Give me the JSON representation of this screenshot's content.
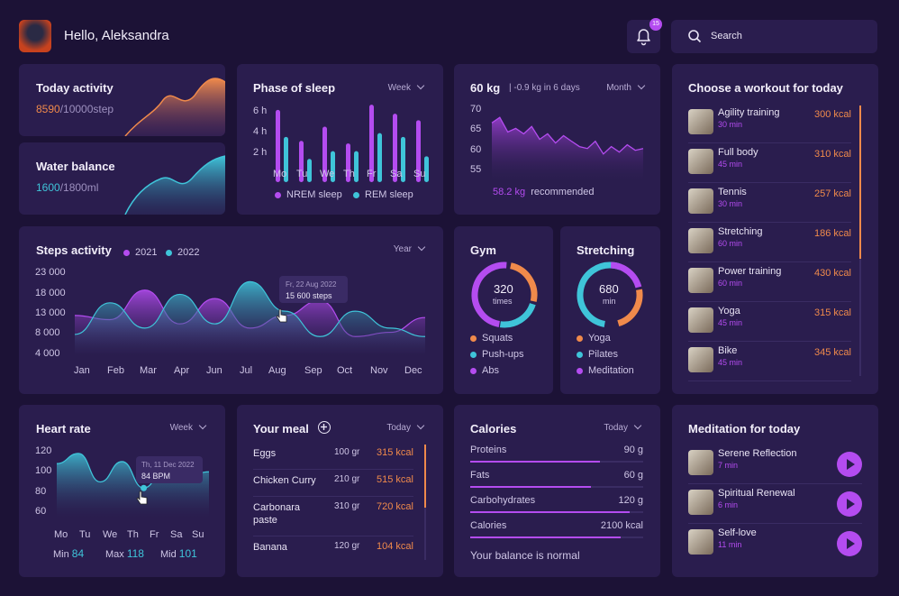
{
  "header": {
    "greeting": "Hello, Aleksandra",
    "notif_count": "15",
    "search_placeholder": "Search"
  },
  "today_activity": {
    "title": "Today activity",
    "value": "8590",
    "total": "/10000step"
  },
  "water": {
    "title": "Water balance",
    "value": "1600",
    "total": "/1800ml"
  },
  "sleep": {
    "title": "Phase of sleep",
    "period": "Week",
    "yticks": [
      "6 h",
      "4 h",
      "2 h"
    ],
    "days": [
      "Mo",
      "Tu",
      "We",
      "Th",
      "Fr",
      "Sa",
      "Su"
    ],
    "legend": [
      "NREM sleep",
      "REM sleep"
    ],
    "chart_data": {
      "type": "bar",
      "categories": [
        "Mo",
        "Tu",
        "We",
        "Th",
        "Fr",
        "Sa",
        "Su"
      ],
      "series": [
        {
          "name": "NREM sleep",
          "values": [
            5.6,
            3.2,
            4.3,
            3.0,
            6.0,
            5.3,
            4.8
          ]
        },
        {
          "name": "REM sleep",
          "values": [
            3.5,
            1.8,
            2.4,
            2.4,
            3.8,
            3.5,
            2.0
          ]
        }
      ],
      "ylim": [
        0,
        6.5
      ]
    }
  },
  "weight": {
    "title": "60 kg",
    "delta": "-0.9 kg in 6 days",
    "period": "Month",
    "yticks": [
      "70",
      "65",
      "60",
      "55"
    ],
    "recommended_value": "58.2 kg",
    "recommended_label": "recommended",
    "chart_data": {
      "type": "area",
      "values": [
        67.0,
        68.5,
        64.5,
        65.5,
        64.0,
        66.0,
        62.5,
        64.0,
        61.5,
        63.5,
        62.0,
        60.5,
        60.0,
        62.0,
        58.5,
        60.5,
        59.0,
        61.0,
        59.5,
        60.0
      ],
      "ylim": [
        54,
        72
      ]
    }
  },
  "workouts": {
    "title": "Choose a workout for today",
    "items": [
      {
        "name": "Agility training",
        "duration": "30 min",
        "kcal": "300 kcal"
      },
      {
        "name": "Full body",
        "duration": "45 min",
        "kcal": "310 kcal"
      },
      {
        "name": "Tennis",
        "duration": "30 min",
        "kcal": "257 kcal"
      },
      {
        "name": "Stretching",
        "duration": "60 min",
        "kcal": "186 kcal"
      },
      {
        "name": "Power training",
        "duration": "60 min",
        "kcal": "430 kcal"
      },
      {
        "name": "Yoga",
        "duration": "45 min",
        "kcal": "315 kcal"
      },
      {
        "name": "Bike",
        "duration": "45 min",
        "kcal": "345 kcal"
      }
    ]
  },
  "steps": {
    "title": "Steps activity",
    "legend": [
      "2021",
      "2022"
    ],
    "period": "Year",
    "yticks": [
      "23 000",
      "18 000",
      "13 000",
      "8 000",
      "4 000"
    ],
    "months": [
      "Jan",
      "Feb",
      "Mar",
      "Apr",
      "Jun",
      "Jul",
      "Aug",
      "Sep",
      "Oct",
      "Nov",
      "Dec"
    ],
    "tooltip_date": "Fr, 22 Aug 2022",
    "tooltip_value": "15 600 steps",
    "chart_data": {
      "type": "area",
      "x": [
        "Jan",
        "Feb",
        "Mar",
        "Apr",
        "Jun",
        "Jul",
        "Aug",
        "Sep",
        "Oct",
        "Nov",
        "Dec"
      ],
      "series": [
        {
          "name": "2021",
          "values": [
            13000,
            12000,
            19000,
            11000,
            17000,
            10000,
            13000,
            16500,
            8000,
            9000,
            12500
          ]
        },
        {
          "name": "2022",
          "values": [
            8500,
            16000,
            10000,
            18000,
            11000,
            21000,
            14000,
            8000,
            14000,
            10000,
            8000
          ]
        }
      ],
      "ylim": [
        4000,
        23000
      ]
    }
  },
  "gym": {
    "title": "Gym",
    "value": "320",
    "unit": "times",
    "items": [
      "Squats",
      "Push-ups",
      "Abs"
    ]
  },
  "stretching": {
    "title": "Stretching",
    "value": "680",
    "unit": "min",
    "items": [
      "Yoga",
      "Pilates",
      "Meditation"
    ]
  },
  "heart": {
    "title": "Heart rate",
    "period": "Week",
    "yticks": [
      "120",
      "100",
      "80",
      "60"
    ],
    "days": [
      "Mo",
      "Tu",
      "We",
      "Th",
      "Fr",
      "Sa",
      "Su"
    ],
    "tooltip_date": "Th, 11 Dec 2022",
    "tooltip_value": "84 BPM",
    "min_label": "Min",
    "min": "84",
    "max_label": "Max",
    "max": "118",
    "mid_label": "Mid",
    "mid": "101",
    "chart_data": {
      "type": "area",
      "values": [
        108,
        118,
        90,
        110,
        84,
        104,
        96,
        100
      ],
      "ylim": [
        55,
        125
      ]
    }
  },
  "meal": {
    "title": "Your meal",
    "period": "Today",
    "items": [
      {
        "name": "Eggs",
        "weight": "100 gr",
        "kcal": "315 kcal"
      },
      {
        "name": "Chicken Curry",
        "weight": "210 gr",
        "kcal": "515 kcal"
      },
      {
        "name": "Carbonara paste",
        "weight": "310 gr",
        "kcal": "720 kcal"
      },
      {
        "name": "Banana",
        "weight": "120 gr",
        "kcal": "104 kcal"
      }
    ]
  },
  "calories": {
    "title": "Calories",
    "period": "Today",
    "rows": [
      {
        "name": "Proteins",
        "value": "90 g",
        "fill": 0.75
      },
      {
        "name": "Fats",
        "value": "60 g",
        "fill": 0.7
      },
      {
        "name": "Carbohydrates",
        "value": "120 g",
        "fill": 0.92
      },
      {
        "name": "Calories",
        "value": "2100 kcal",
        "fill": 0.87
      }
    ],
    "status": "Your balance is normal"
  },
  "meditation": {
    "title": "Meditation for today",
    "items": [
      {
        "name": "Serene Reflection",
        "duration": "7 min"
      },
      {
        "name": "Spiritual Renewal",
        "duration": "6 min"
      },
      {
        "name": "Self-love",
        "duration": "11 min"
      }
    ]
  },
  "colors": {
    "bg": "#1c1236",
    "card": "#2a1d4e",
    "orange": "#f08a4b",
    "purple": "#b44cf0",
    "teal": "#3fc4d9"
  }
}
